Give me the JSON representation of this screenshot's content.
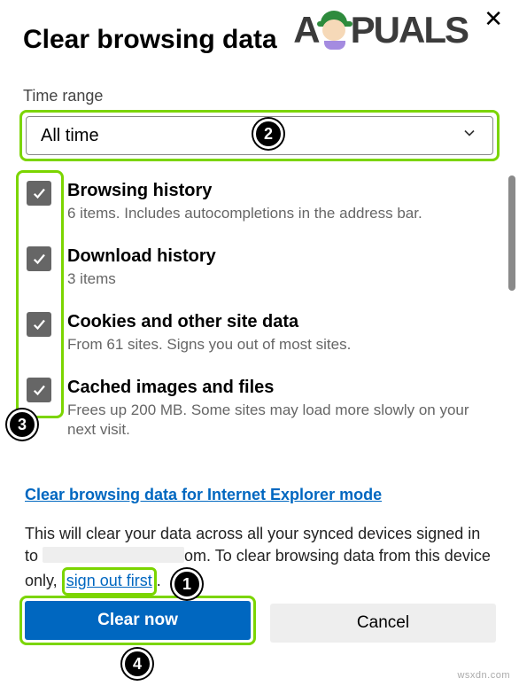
{
  "brand": {
    "pre": "A",
    "post": "PUALS"
  },
  "title": "Clear browsing data",
  "time_range": {
    "label": "Time range",
    "value": "All time"
  },
  "items": [
    {
      "title": "Browsing history",
      "desc": "6 items. Includes autocompletions in the address bar.",
      "checked": true
    },
    {
      "title": "Download history",
      "desc": "3 items",
      "checked": true
    },
    {
      "title": "Cookies and other site data",
      "desc": "From 61 sites. Signs you out of most sites.",
      "checked": true
    },
    {
      "title": "Cached images and files",
      "desc": "Frees up 200 MB. Some sites may load more slowly on your next visit.",
      "checked": true
    }
  ],
  "ie_link": "Clear browsing data for Internet Explorer mode",
  "info": {
    "pre": "This will clear your data across all your synced devices signed in to ",
    "mid": "om. To clear browsing data from this device only, ",
    "signout": "sign out first",
    "post": "."
  },
  "buttons": {
    "primary": "Clear now",
    "secondary": "Cancel"
  },
  "watermark": "wsxdn.com",
  "badges": {
    "b1": "1",
    "b2": "2",
    "b3": "3",
    "b4": "4"
  }
}
